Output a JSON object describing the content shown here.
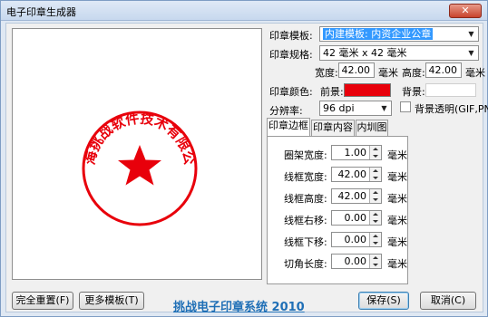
{
  "window": {
    "title": "电子印章生成器",
    "close_label": "✕"
  },
  "labels": {
    "template": "印章模板:",
    "spec": "印章规格:",
    "width": "宽度:",
    "height": "高度:",
    "unit_mm": "毫米",
    "color": "印章颜色:",
    "foreground": "前景:",
    "background": "背景:",
    "resolution": "分辨率:",
    "transparent": "背景透明(GIF,PNG)"
  },
  "values": {
    "template": "内建模板: 内资企业公章",
    "spec": "42 毫米 x 42 毫米",
    "width": "42.00",
    "height": "42.00",
    "resolution": "96 dpi",
    "foreground_color": "#e8000b",
    "background_color": "#ffffff",
    "transparent_checked": false
  },
  "tabs": [
    "印章边框",
    "印章内容",
    "内圳图"
  ],
  "border_fields": [
    {
      "label": "圈架宽度:",
      "value": "1.00",
      "unit": "毫米"
    },
    {
      "label": "线框宽度:",
      "value": "42.00",
      "unit": "毫米"
    },
    {
      "label": "线框高度:",
      "value": "42.00",
      "unit": "毫米"
    },
    {
      "label": "线框右移:",
      "value": "0.00",
      "unit": "毫米"
    },
    {
      "label": "线框下移:",
      "value": "0.00",
      "unit": "毫米"
    },
    {
      "label": "切角长度:",
      "value": "0.00",
      "unit": "毫米"
    }
  ],
  "seal": {
    "text": "上海挑战软件技术有限公司",
    "color": "#e8000b"
  },
  "buttons": {
    "reset": "完全重置(F)",
    "more_templates": "更多模板(T)",
    "save": "保存(S)",
    "cancel": "取消(C)"
  },
  "footer_title": "挑战电子印章系统 2010"
}
